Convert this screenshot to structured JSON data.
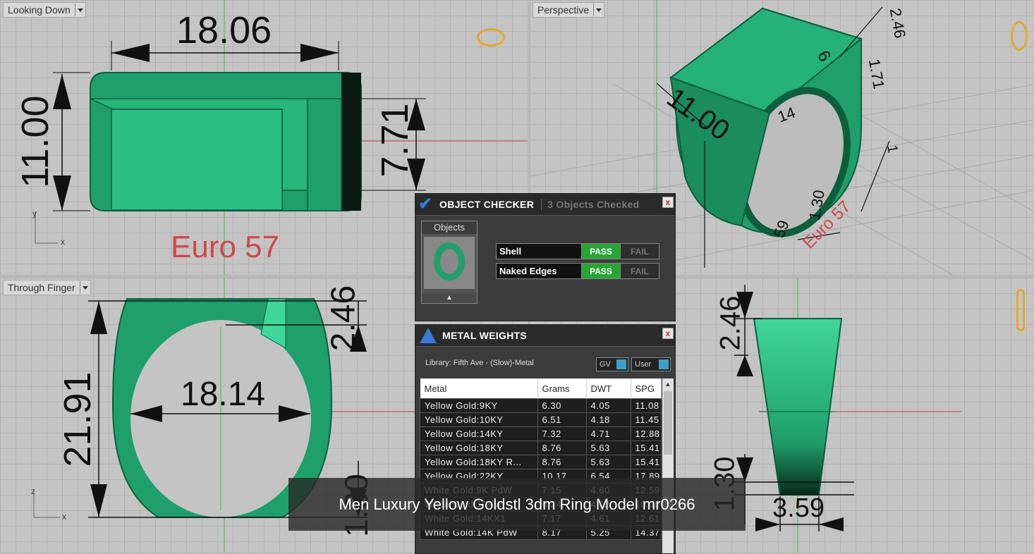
{
  "viewports": {
    "top_left": {
      "label": "Looking Down",
      "dim_width": "18.06",
      "dim_height": "11.00",
      "dim_inner": "7.71",
      "size_label": "Euro 57",
      "axis_y": "y",
      "axis_x": "x"
    },
    "top_right": {
      "label": "Perspective",
      "dims": [
        "2.46",
        "6",
        "1.71",
        "11.00",
        "14",
        "1",
        "1.30",
        "59"
      ],
      "size_label": "Euro 57"
    },
    "bottom_left": {
      "label": "Through Finger",
      "dim_top": "2.46",
      "dim_height": "21.91",
      "dim_inner": "18.14",
      "dim_bottom": "1.30",
      "axis_z": "z",
      "axis_x": "x"
    },
    "bottom_right": {
      "dim_top": "2.46",
      "dim_bottom": "1.30",
      "dim_width": "3.59"
    }
  },
  "object_checker": {
    "title": "OBJECT CHECKER",
    "status": "3  Objects Checked",
    "objects_label": "Objects",
    "close": "x",
    "rows": [
      {
        "label": "Shell",
        "pass": "PASS",
        "fail": "FAIL"
      },
      {
        "label": "Naked Edges",
        "pass": "PASS",
        "fail": "FAIL"
      }
    ]
  },
  "metal_weights": {
    "title": "METAL WEIGHTS",
    "close": "x",
    "library": "Library: Fifth Ave - (Slow)-Metal",
    "toggle_gv": "GV",
    "toggle_user": "User",
    "columns": [
      "Metal",
      "Grams",
      "DWT",
      "SPG"
    ],
    "rows": [
      [
        "Yellow Gold:9KY",
        "6.30",
        "4.05",
        "11.08"
      ],
      [
        "Yellow Gold:10KY",
        "6.51",
        "4.18",
        "11.45"
      ],
      [
        "Yellow Gold:14KY",
        "7.32",
        "4.71",
        "12.88"
      ],
      [
        "Yellow Gold:18KY",
        "8.76",
        "5.63",
        "15.41"
      ],
      [
        "Yellow Gold:18KY R...",
        "8.76",
        "5.63",
        "15.41"
      ],
      [
        "Yellow Gold:22KY",
        "10.17",
        "6.54",
        "17.89"
      ],
      [
        "White Gold:9K PdW",
        "7.15",
        "4.60",
        "12.59"
      ],
      [
        "White Gold:10KW",
        "6.24",
        "4.02",
        "10.99"
      ],
      [
        "White Gold:14KX1",
        "7.17",
        "4.61",
        "12.61"
      ],
      [
        "White Gold:14K PdW",
        "8.17",
        "5.25",
        "14.37"
      ]
    ]
  },
  "caption": "Men Luxury Yellow Goldstl 3dm Ring Model mr0266",
  "colors": {
    "ring_green": "#1f9f6e",
    "dim_red": "#d0484a",
    "pass_green": "#27a535"
  }
}
